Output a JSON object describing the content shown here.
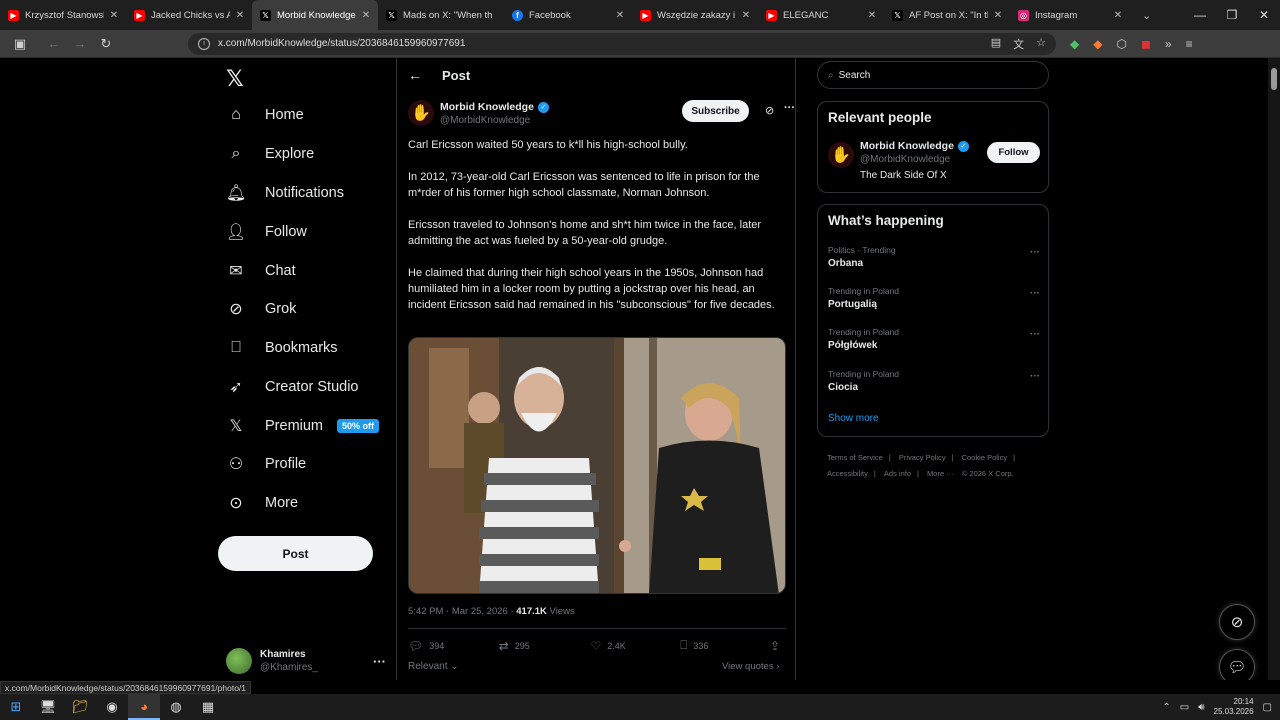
{
  "browser": {
    "tabs": [
      {
        "title": "Krzysztof Stanowski. W ja",
        "favicon": "youtube-icon",
        "color": "#ff0000",
        "active": false
      },
      {
        "title": "Jacked Chicks vs Average",
        "favicon": "youtube-icon",
        "color": "#ff0000",
        "active": false
      },
      {
        "title": "Morbid Knowledge on X:",
        "favicon": "x-icon",
        "color": "#000000",
        "active": true
      },
      {
        "title": "Mads on X: \"When th",
        "favicon": "x-icon",
        "color": "#000000",
        "active": false
      },
      {
        "title": "Facebook",
        "favicon": "facebook-icon",
        "color": "#1877f2",
        "active": false
      },
      {
        "title": "Wszędzie zakazy i preten",
        "favicon": "youtube-icon",
        "color": "#ff0000",
        "active": false
      },
      {
        "title": "ELEGANC",
        "favicon": "youtube-icon",
        "color": "#ff0000",
        "active": false
      },
      {
        "title": "AF Post on X: \"In the first",
        "favicon": "x-icon",
        "color": "#000000",
        "active": false
      },
      {
        "title": "Instagram",
        "favicon": "instagram-icon",
        "color": "#d62976",
        "active": false
      }
    ],
    "url": "x.com/MorbidKnowledge/status/2036846159960977691",
    "status_url": "x.com/MorbidKnowledge/status/2036846159960977691/photo/1"
  },
  "nav": {
    "items": [
      {
        "label": "Home",
        "icon": "home-icon"
      },
      {
        "label": "Explore",
        "icon": "search-icon"
      },
      {
        "label": "Notifications",
        "icon": "bell-icon"
      },
      {
        "label": "Follow",
        "icon": "follow-icon"
      },
      {
        "label": "Chat",
        "icon": "mail-icon"
      },
      {
        "label": "Grok",
        "icon": "grok-icon"
      },
      {
        "label": "Bookmarks",
        "icon": "bookmark-icon"
      },
      {
        "label": "Creator Studio",
        "icon": "rocket-icon"
      },
      {
        "label": "Premium",
        "icon": "x-icon"
      },
      {
        "label": "Profile",
        "icon": "person-icon"
      },
      {
        "label": "More",
        "icon": "more-circle-icon"
      }
    ],
    "premium_badge": "50% off",
    "post_button": "Post",
    "account": {
      "name": "Khamires",
      "handle": "@Khamires_"
    }
  },
  "post": {
    "header_title": "Post",
    "author_name": "Morbid Knowledge",
    "author_handle": "@MorbidKnowledge",
    "subscribe_label": "Subscribe",
    "paragraphs": [
      "Carl Ericsson waited 50 years to k*ll his high-school bully.",
      "In 2012, 73-year-old Carl Ericsson was sentenced to life in prison for the m*rder of his former high school classmate, Norman Johnson.",
      "Ericsson traveled to Johnson's home and sh*t him twice in the face, later admitting the act was fueled by a 50-year-old grudge.",
      "He claimed that during their high school years in the 1950s, Johnson had humiliated him in a locker room by putting a jockstrap over his head, an incident Ericsson said had remained in his \"subconscious\" for five decades."
    ],
    "timestamp": "5:42 PM · Mar 25, 2026 · ",
    "views_count": "417.1K",
    "views_label": " Views",
    "replies": "394",
    "reposts": "295",
    "likes": "2.4K",
    "bookmarks": "336",
    "sort_label": "Relevant",
    "view_quotes": "View quotes"
  },
  "sidebar": {
    "search_placeholder": "Search",
    "relevant_title": "Relevant people",
    "relevant": {
      "name": "Morbid Knowledge",
      "handle": "@MorbidKnowledge",
      "bio": "The Dark Side Of X",
      "follow_label": "Follow"
    },
    "happening_title": "What’s happening",
    "trends": [
      {
        "context": "Politics · Trending",
        "topic": "Orbana"
      },
      {
        "context": "Trending in Poland",
        "topic": "Portugalią"
      },
      {
        "context": "Trending in Poland",
        "topic": "Półgłówek"
      },
      {
        "context": "Trending in Poland",
        "topic": "Ciocia"
      }
    ],
    "show_more": "Show more",
    "footer_links": [
      "Terms of Service",
      "Privacy Policy",
      "Cookie Policy",
      "Accessibility",
      "Ads info",
      "More ···",
      "© 2026 X Corp."
    ]
  },
  "taskbar": {
    "time": "20:14",
    "date": "25.03.2026"
  },
  "colors": {
    "accent": "#1d9bf0",
    "bg": "#000000",
    "border": "#2f3336",
    "muted": "#71767b"
  }
}
